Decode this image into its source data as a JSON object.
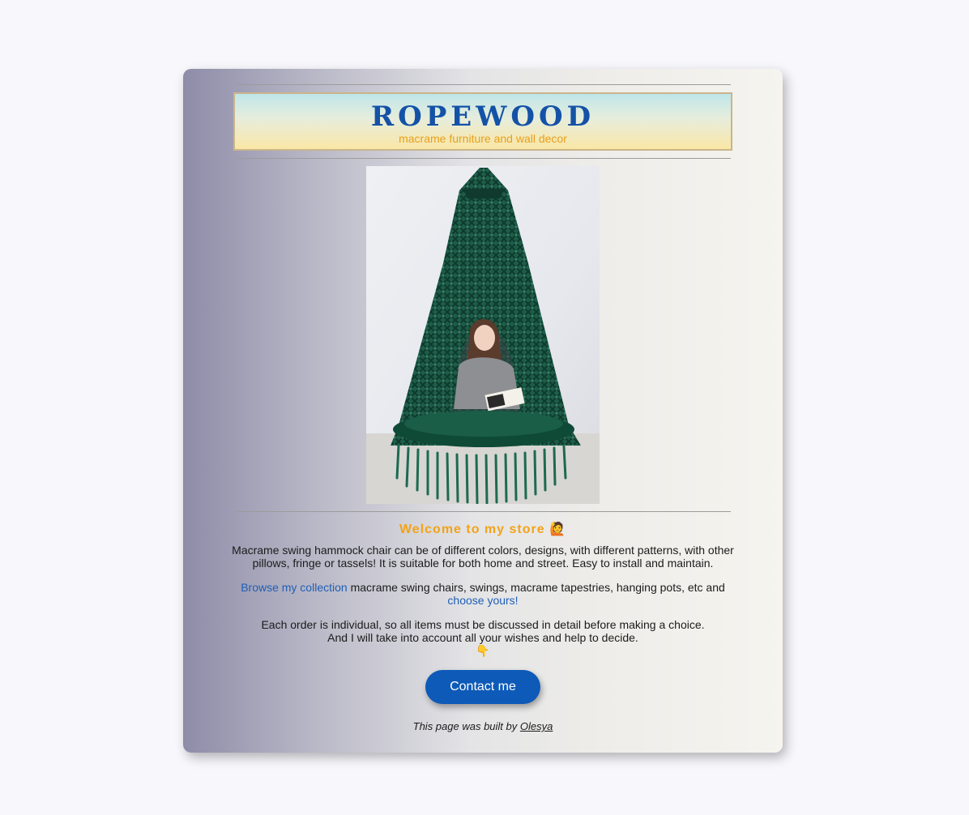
{
  "header": {
    "brand": "ROPEWOOD",
    "tagline": "macrame furniture and wall decor"
  },
  "hero": {
    "alt": "Macrame swing hammock chair"
  },
  "welcome": {
    "heading": "Welcome to my store",
    "emoji": "🙋"
  },
  "intro": {
    "text": "Macrame swing hammock chair can be of different colors, designs, with different patterns, with other pillows, fringe or tassels! It is suitable for both home and street. Easy to install and maintain."
  },
  "collection": {
    "link_label": "Browse my collection",
    "text": " macrame swing chairs, swings, macrame tapestries, hanging pots, etc and ",
    "choose_label": "choose yours!"
  },
  "order": {
    "line1": "Each order is individual, so all items must be discussed in detail before making a choice.",
    "line2": "And I will take into account all your wishes and help to decide.",
    "pointer": "👇"
  },
  "contact_button": {
    "label": "Contact me"
  },
  "footer": {
    "prefix": "This page was built by ",
    "author": "Olesya"
  },
  "colors": {
    "brand": "#1452a7",
    "accent": "#f2a31a",
    "button": "#0e5ab8",
    "link": "#1f5fb5"
  }
}
